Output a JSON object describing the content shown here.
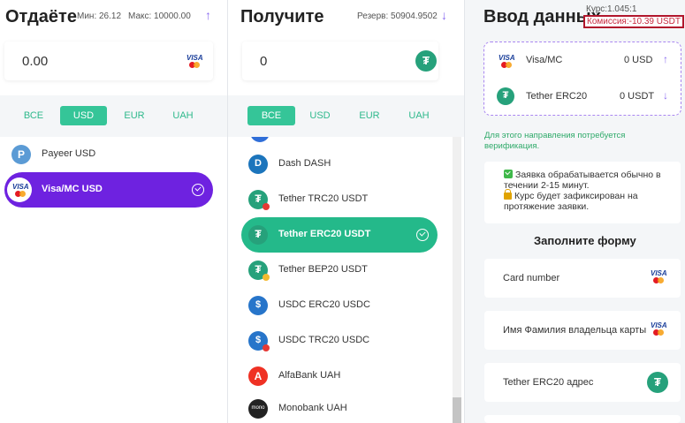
{
  "give": {
    "title": "Отдаёте",
    "min_label": "Мин: 26.12",
    "max_label": "Макс: 10000.00",
    "amount": "0.00",
    "tabs": [
      "ВСЕ",
      "USD",
      "EUR",
      "UAH"
    ],
    "active_tab": "USD",
    "items": [
      {
        "label": "Payeer USD",
        "icon": "payeer-icon"
      },
      {
        "label": "Visa/MC USD",
        "icon": "visa-mastercard-icon",
        "selected": true
      }
    ]
  },
  "get": {
    "title": "Получите",
    "reserve_label": "Резерв: 50904.9502",
    "amount": "0",
    "tabs": [
      "ВСЕ",
      "USD",
      "EUR",
      "UAH"
    ],
    "active_tab": "ВСЕ",
    "items": [
      {
        "label": "Dash DASH",
        "icon": "dash-icon"
      },
      {
        "label": "Tether TRC20 USDT",
        "icon": "tether-icon"
      },
      {
        "label": "Tether ERC20 USDT",
        "icon": "tether-icon",
        "selected": true
      },
      {
        "label": "Tether BEP20 USDT",
        "icon": "tether-icon"
      },
      {
        "label": "USDC ERC20 USDC",
        "icon": "usdc-icon"
      },
      {
        "label": "USDC TRC20 USDC",
        "icon": "usdc-icon"
      },
      {
        "label": "AlfaBank UAH",
        "icon": "alfabank-icon"
      },
      {
        "label": "Monobank UAH",
        "icon": "monobank-icon"
      }
    ]
  },
  "details": {
    "title": "Ввод данных",
    "rate": "Курс:1.045:1",
    "commission": "Комиссия:-10.39 USDT",
    "from": {
      "name": "Visa/MC",
      "value": "0 USD"
    },
    "to": {
      "name": "Tether ERC20",
      "value": "0 USDT"
    },
    "verification_notice": "Для этого направления потребуется верификация.",
    "info_line1": "Заявка обрабатывается обычно в течении 2-15 минут.",
    "info_line2": "Курс будет зафиксирован на протяжение заявки.",
    "form_title": "Заполните форму",
    "fields": [
      {
        "placeholder": "Card number",
        "icon": "visa-mastercard-icon"
      },
      {
        "placeholder": "Имя Фамилия владельца карты",
        "icon": "visa-mastercard-icon"
      },
      {
        "placeholder": "Tether ERC20 адрес",
        "icon": "tether-icon"
      }
    ]
  },
  "colors": {
    "accent_green": "#35c598",
    "selected_purple": "#6e22e0",
    "selected_green": "#24b98a",
    "commission_red": "#b1162c"
  }
}
